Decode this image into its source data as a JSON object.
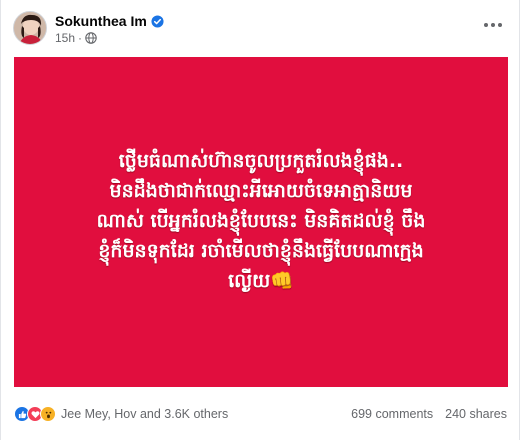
{
  "post": {
    "author": "Sokunthea Im",
    "time": "15h",
    "separator": "·",
    "verified": true,
    "icons": {
      "avatar": "profile-photo",
      "verified": "verified-badge-icon",
      "privacy": "globe-icon",
      "more": "more-options-icon"
    },
    "banner": {
      "background_color": "#e10e3e",
      "text_color": "#ffffff",
      "lines": [
        "ថ្លើមធំណាស់ហ៊ានចូលប្រកួតរំលងខ្ញុំផង..",
        "មិនដឹងថាជាក់ឈ្មោះអីអោយចំទេអាត្មានិយម",
        "ណាស់ បើអ្នករំលងខ្ញុំបែបនេះ មិនគិតដល់ខ្ញុំ ចឹង",
        "ខ្ញុំក៏មិនទុកដែរ រចាំមើលថាខ្ញុំនឹងធ្វើបែបណាក្មេង",
        "ល្ងើយ👊"
      ]
    },
    "reactions": {
      "types": [
        "like",
        "love",
        "wow"
      ],
      "summary": "Jee Mey, Hov and 3.6K others"
    },
    "comments": "699 comments",
    "shares": "240 shares"
  },
  "colors": {
    "accent": "#1b74e4",
    "secondary_text": "#65676b"
  }
}
